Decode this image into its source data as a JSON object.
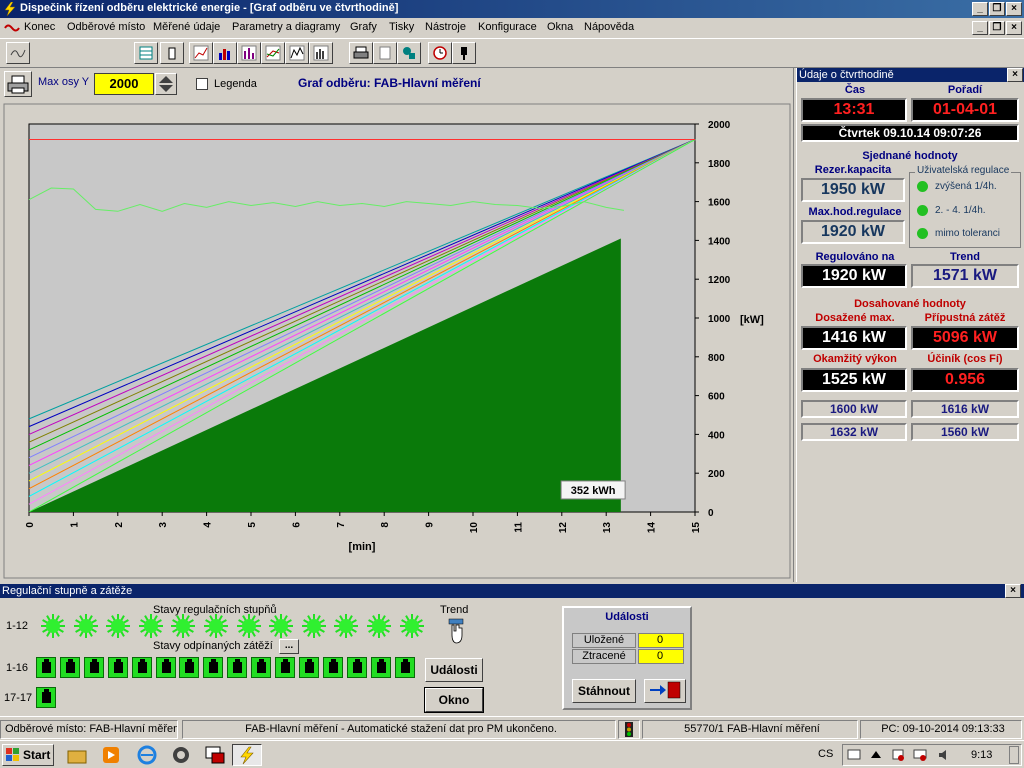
{
  "window": {
    "title": "Dispečink řízení odběru elektrické energie - [Graf odběru ve čtvrthodině]"
  },
  "menu": [
    "Konec",
    "Odběrové místo",
    "Měřené údaje",
    "Parametry a diagramy",
    "Grafy",
    "Tisky",
    "Nástroje",
    "Konfigurace",
    "Okna",
    "Nápověda"
  ],
  "graph_header": {
    "max_y_label": "Max osy Y",
    "max_y_value": "2000",
    "legend_label": "Legenda",
    "title": "Graf odběru: FAB-Hlavní měření"
  },
  "chart_data": {
    "type": "line",
    "xlabel": "[min]",
    "ylabel": "[kW]",
    "xlim": [
      0,
      15
    ],
    "ylim": [
      0,
      2000
    ],
    "x_ticks": [
      0,
      1,
      2,
      3,
      4,
      5,
      6,
      7,
      8,
      9,
      10,
      11,
      12,
      13,
      14,
      15
    ],
    "y_ticks": [
      0,
      200,
      400,
      600,
      800,
      1000,
      1200,
      1400,
      1600,
      1800,
      2000
    ],
    "limit_line_kw": 1920,
    "fan_lines": {
      "end_point": [
        15,
        1920
      ],
      "start_values_kw": [
        480,
        440,
        400,
        360,
        320,
        280,
        240,
        200,
        160,
        120,
        80,
        40,
        0
      ],
      "colors": [
        "#00a0a0",
        "#0000c0",
        "#c000c0",
        "#808000",
        "#00c000",
        "#8080ff",
        "#ff40ff",
        "#40c0c0",
        "#ffff00",
        "#ff8000",
        "#00ffff",
        "#ff80ff",
        "#40ff40"
      ]
    },
    "power_series": {
      "color": "#66ee66",
      "x": [
        0,
        0.5,
        1,
        1.5,
        2,
        2.5,
        3,
        3.5,
        4,
        4.5,
        5,
        5.5,
        6,
        6.5,
        7,
        7.5,
        8,
        8.5,
        9,
        9.5,
        10,
        10.5,
        11,
        11.5,
        12,
        12.5,
        13,
        13.4
      ],
      "y": [
        1610,
        1670,
        1665,
        1560,
        1550,
        1585,
        1550,
        1590,
        1570,
        1600,
        1580,
        1595,
        1575,
        1600,
        1580,
        1590,
        1575,
        1600,
        1590,
        1580,
        1600,
        1585,
        1580,
        1565,
        1575,
        1600,
        1570,
        1555
      ]
    },
    "energy_area": {
      "color": "#0a7a0a",
      "end_x": 13.33,
      "end_value": 1410
    },
    "annotation": "352 kWh",
    "annotation_x": 12.3
  },
  "right_panel": {
    "title": "Údaje o čtvrthodině",
    "cas_label": "Čas",
    "cas_value": "13:31",
    "poradi_label": "Pořadí",
    "poradi_value": "01-04-01",
    "datetime": "Čtvrtek  09.10.14  09:07:26",
    "sjednane_label": "Sjednané hodnoty",
    "rezer_label": "Rezer.kapacita",
    "rezer_value": "1950 kW",
    "maxhod_label": "Max.hod.regulace",
    "maxhod_value": "1920 kW",
    "uziv_label": "Uživatelská regulace",
    "uziv_items": [
      "zvýšená 1/4h.",
      "2. - 4. 1/4h.",
      "mimo toleranci"
    ],
    "regulovano_label": "Regulováno na",
    "regulovano_value": "1920 kW",
    "trend_label": "Trend",
    "trend_value": "1571 kW",
    "dosahovane_label": "Dosahované hodnoty",
    "dosazene_label": "Dosažené max.",
    "dosazene_value": "1416 kW",
    "pripustna_label": "Přípustná zátěž",
    "pripustna_value": "5096 kW",
    "okamzity_label": "Okamžitý výkon",
    "okamzity_value": "1525 kW",
    "ucinik_label": "Účiník (cos Fí)",
    "ucinik_value": "0.956",
    "extra": [
      "1600 kW",
      "1616 kW",
      "1632 kW",
      "1560 kW"
    ]
  },
  "bottom": {
    "title": "Regulační stupně a zátěže",
    "stavy_reg_label": "Stavy regulačních stupňů",
    "row1_label": "1-12",
    "trend_label": "Trend",
    "stavy_odp_label": "Stavy odpínaných zátěží",
    "more_btn": "...",
    "row2_label": "1-16",
    "row3_label": "17-17",
    "udalosti_btn": "Události",
    "okno_btn": "Okno",
    "udalosti_title": "Události",
    "ulozene_label": "Uložené",
    "ulozene_value": "0",
    "ztracene_label": "Ztracené",
    "ztracene_value": "0",
    "stahnout_btn": "Stáhnout"
  },
  "status": {
    "place": "Odběrové místo: FAB-Hlavní měření",
    "message": "FAB-Hlavní měření - Automatické stažení dat pro PM ukončeno.",
    "device": "55770/1 FAB-Hlavní měření",
    "pc_time": "PC: 09-10-2014 09:13:33"
  },
  "taskbar": {
    "start": "Start",
    "lang": "CS",
    "clock": "9:13"
  }
}
